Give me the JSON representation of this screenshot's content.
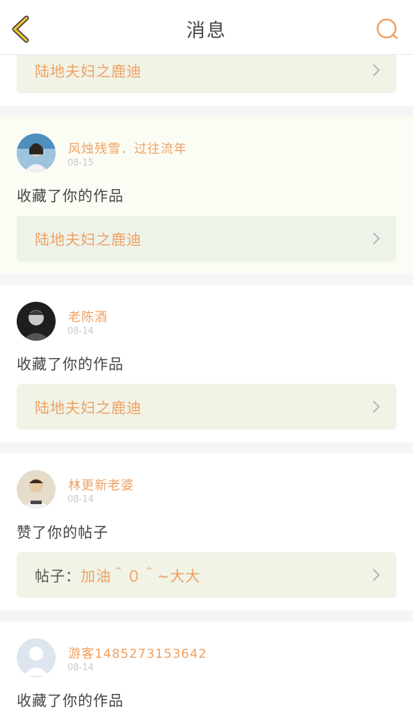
{
  "header": {
    "title": "消息"
  },
  "colors": {
    "accent": "#f0a060",
    "work_bg": "#f0f3e6",
    "highlight_bg": "#fbfdf5"
  },
  "top_card": {
    "work_title": "陆地夫妇之鹿迪"
  },
  "messages": [
    {
      "user": "风烛残雪．过往流年",
      "date": "08-15",
      "action": "收藏了你的作品",
      "work_prefix": "",
      "work_title": "陆地夫妇之鹿迪"
    },
    {
      "user": "老陈酒",
      "date": "08-14",
      "action": "收藏了你的作品",
      "work_prefix": "",
      "work_title": "陆地夫妇之鹿迪"
    },
    {
      "user": "林更新老婆",
      "date": "08-14",
      "action": "赞了你的帖子",
      "work_prefix": "帖子：",
      "work_title": "加油＾０＾~大大"
    },
    {
      "user": "游客1485273153642",
      "date": "08-14",
      "action": "收藏了你的作品"
    }
  ]
}
